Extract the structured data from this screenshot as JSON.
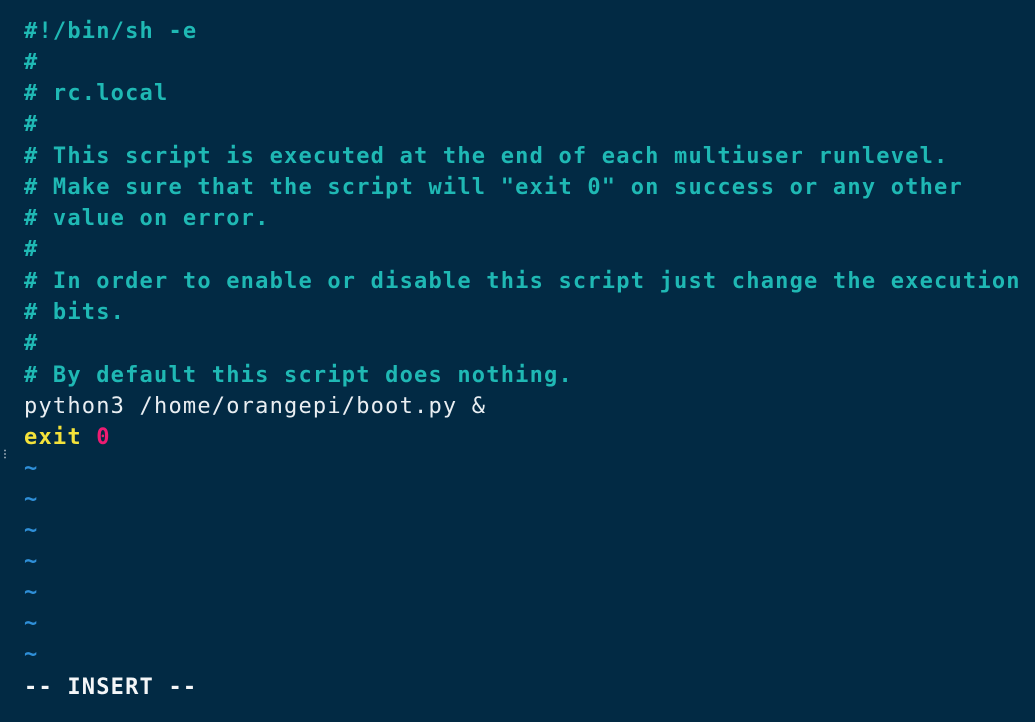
{
  "editor": {
    "comment_lines": [
      "#!/bin/sh -e",
      "#",
      "# rc.local",
      "#",
      "# This script is executed at the end of each multiuser runlevel.",
      "# Make sure that the script will \"exit 0\" on success or any other",
      "# value on error.",
      "#",
      "# In order to enable or disable this script just change the execution",
      "# bits.",
      "#",
      "# By default this script does nothing."
    ],
    "command_line": "python3 /home/orangepi/boot.py &",
    "exit_keyword": "exit",
    "exit_code": "0",
    "tilde_lines": [
      "~",
      "~",
      "~",
      "~",
      "~",
      "~",
      "~"
    ],
    "mode_indicator": "-- INSERT --"
  },
  "colors": {
    "background": "#022a44",
    "comment": "#1fb8b4",
    "plain_text": "#e9eef2",
    "keyword": "#f4e23a",
    "number": "#ee1c72",
    "tilde": "#2f8fd8",
    "status_text": "#f4f6f8"
  }
}
